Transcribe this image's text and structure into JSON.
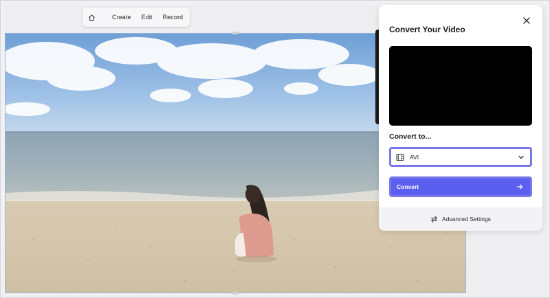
{
  "toolbar": {
    "home_icon": "home-icon",
    "items": [
      "Create",
      "Edit",
      "Record"
    ]
  },
  "panel": {
    "title": "Convert Your Video",
    "convert_to_label": "Convert to...",
    "format": {
      "icon": "film-icon",
      "selected": "AVI"
    },
    "convert_button": "Convert",
    "advanced_settings": "Advanced Settings"
  },
  "colors": {
    "accent": "#5b5ff0",
    "accent_border": "#7b77e6",
    "panel_bg": "#ffffff",
    "preview_bg": "#000000"
  }
}
